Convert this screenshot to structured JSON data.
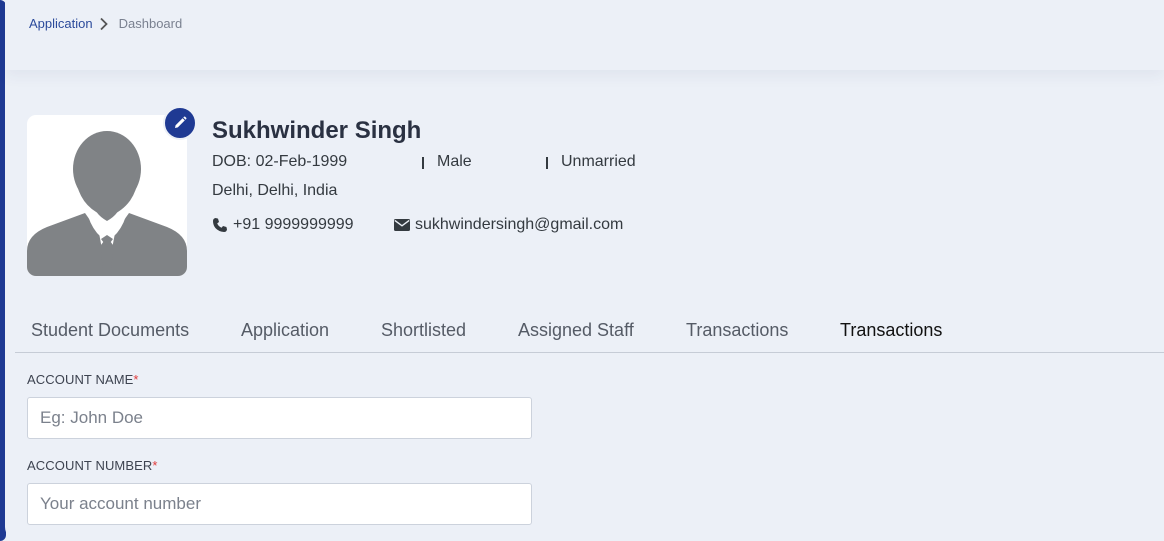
{
  "breadcrumb": {
    "root": "Application",
    "current": "Dashboard"
  },
  "profile": {
    "name": "Sukhwinder Singh",
    "dob": "DOB: 02-Feb-1999",
    "gender": "Male",
    "marital_status": "Unmarried",
    "location": "Delhi, Delhi, India",
    "phone": "+91 9999999999",
    "email": "sukhwindersingh@gmail.com"
  },
  "tabs": [
    {
      "label": "Student Documents"
    },
    {
      "label": "Application"
    },
    {
      "label": "Shortlisted"
    },
    {
      "label": "Assigned Staff"
    },
    {
      "label": "Transactions"
    },
    {
      "label": "Transactions"
    }
  ],
  "form": {
    "account_name": {
      "label": "ACCOUNT NAME",
      "required_mark": "*",
      "placeholder": "Eg: John Doe"
    },
    "account_number": {
      "label": "ACCOUNT NUMBER",
      "required_mark": "*",
      "placeholder": "Your account number"
    }
  },
  "colors": {
    "accent": "#1f3a93",
    "background": "#ecf0f7",
    "required": "#e03a3a"
  },
  "icons": {
    "edit": "pencil-icon",
    "phone": "phone-icon",
    "email": "envelope-icon",
    "breadcrumb_separator": "chevron-right-icon"
  }
}
